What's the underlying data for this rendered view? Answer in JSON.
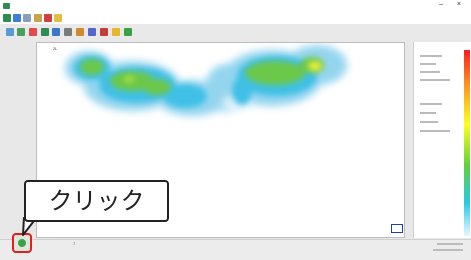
{
  "window": {
    "title": "",
    "controls": "– ×"
  },
  "toolbar1": {
    "buttons": [
      "home-icon",
      "save-icon",
      "grid-icon",
      "pen-icon",
      "chart-icon",
      "settings-icon"
    ]
  },
  "toolbar2": {
    "buttons": [
      "select-icon",
      "zoom-icon",
      "color-icon",
      "record-icon",
      "layers-icon",
      "print-icon",
      "export-icon",
      "compare-icon",
      "report-icon",
      "help-icon",
      "leaf-icon"
    ]
  },
  "canvas": {
    "tag": "2L"
  },
  "sidebar": {
    "section1_heading": "",
    "section2_heading": "",
    "scale_colors": [
      "#ff1e1e",
      "#ff9a1e",
      "#ffff1e",
      "#5fd23a",
      "#28c8e6",
      "#e6f7ff"
    ]
  },
  "status": {
    "mark": "7"
  },
  "callout": {
    "text": "クリック"
  },
  "colors": {
    "highlight": "#e02020",
    "selection": "#1e3fb0"
  }
}
